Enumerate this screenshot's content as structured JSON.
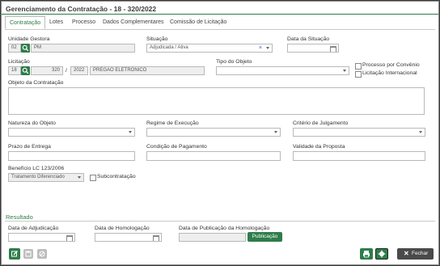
{
  "window": {
    "title": "Gerenciamento da Contratação - 18 - 320/2022"
  },
  "tabs": [
    "Contratação",
    "Lotes",
    "Processo",
    "Dados Complementares",
    "Comissão de Licitação"
  ],
  "form": {
    "unidade_gestora": {
      "label": "Unidade Gestora",
      "code": "02",
      "name": "PM"
    },
    "situacao": {
      "label": "Situação",
      "value": "Adjudicada / Ativa"
    },
    "data_situacao": {
      "label": "Data da Situação",
      "value": ""
    },
    "licitacao": {
      "label": "Licitação",
      "code": "18",
      "number": "320",
      "sep": "/",
      "year": "2022",
      "modalidade": "PREGÃO ELETRÔNICO"
    },
    "tipo_objeto": {
      "label": "Tipo do Objeto",
      "value": ""
    },
    "processo_convenio": {
      "label": "Processo por Convênio"
    },
    "licitacao_internacional": {
      "label": "Licitação Internacional"
    },
    "objeto": {
      "label": "Objeto da Contratação",
      "value": ""
    },
    "natureza": {
      "label": "Natureza do Objeto",
      "value": ""
    },
    "regime": {
      "label": "Regime de Execução",
      "value": ""
    },
    "criterio": {
      "label": "Critério de Julgamento",
      "value": ""
    },
    "prazo": {
      "label": "Prazo de Entrega",
      "value": ""
    },
    "condicao": {
      "label": "Condição de Pagamento",
      "value": ""
    },
    "validade": {
      "label": "Validade da Proposta",
      "value": ""
    },
    "beneficio": {
      "label": "Benefício LC 123/2006",
      "value": "Tratamento Diferenciado"
    },
    "subcontratacao": {
      "label": "Subcontratação"
    }
  },
  "resultado": {
    "title": "Resultado",
    "adjudicacao": {
      "label": "Data de Adjudicação",
      "value": ""
    },
    "homologacao": {
      "label": "Data de Homologação",
      "value": ""
    },
    "publicacao": {
      "label": "Data de Publicação da Homologação",
      "value": ""
    },
    "publicacao_button": "Publicação"
  },
  "footer": {
    "close_label": "Fechar"
  },
  "icons": [
    "search-icon",
    "edit-icon",
    "save-icon",
    "cancel-icon",
    "print-icon",
    "gear-icon",
    "close-icon",
    "calendar-icon",
    "chevron-down-icon",
    "clear-icon"
  ],
  "colors": {
    "accent": "#2e7d4a",
    "dark_button": "#4a4a4a"
  }
}
